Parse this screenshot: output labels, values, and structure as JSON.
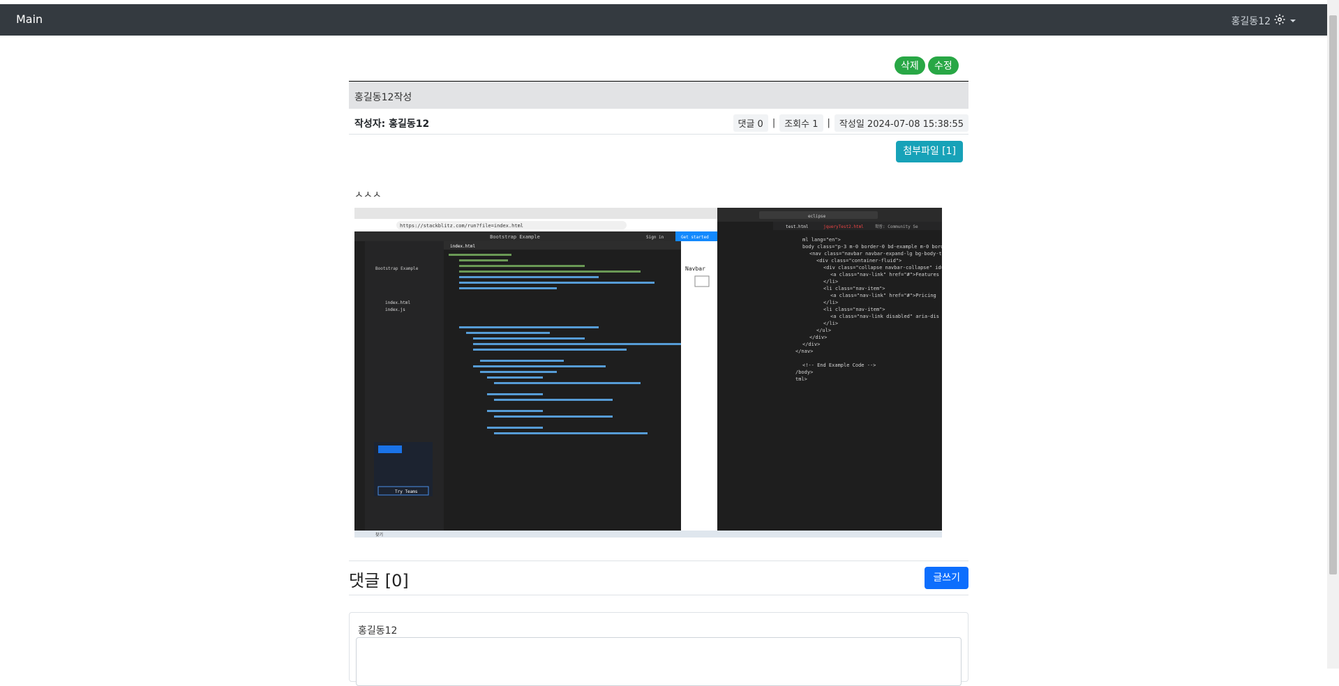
{
  "navbar": {
    "brand": "Main",
    "user": "홍길동12"
  },
  "post": {
    "delete_label": "삭제",
    "edit_label": "수정",
    "title": "홍길동12작성",
    "author": "작성자: 홍길동12",
    "comment_count": "댓글 0",
    "view_count": "조회수 1",
    "date": "작성일 2024-07-08 15:38:55",
    "attachment_label": "첨부파일 [1]",
    "content": "ㅅㅅㅅ",
    "screenshot": {
      "address": "https://stackblitz.com/run?file=index.html",
      "panel_title": "Bootstrap Example",
      "file_tab": "index.html",
      "preview_label": "Navbar",
      "sign_in": "Sign in",
      "get_started": "Get started",
      "files": [
        "index.html",
        "index.js"
      ],
      "side_title": "Bootstrap Example",
      "try_teams": "Try Teams",
      "search_box": "eclipse",
      "editor_tabs": [
        "test.html",
        "jqueryTest2.html",
        "확장: Community Se"
      ],
      "taskbar_search": "찾기",
      "code_lines": [
        "ml lang=\"en\">",
        "body class=\"p-3 m-0 border-0 bd-example m-0 borde",
        "<nav class=\"navbar navbar-expand-lg bg-body-ter",
        "<div class=\"container-fluid\">",
        "<div class=\"collapse navbar-collapse\" id=",
        "<a class=\"nav-link\" href=\"#\">Features",
        "</li>",
        "<li class=\"nav-item\">",
        "<a class=\"nav-link\" href=\"#\">Pricing",
        "</li>",
        "<li class=\"nav-item\">",
        "<a class=\"nav-link disabled\" aria-dis",
        "</li>",
        "</ul>",
        "</div>",
        "</div>",
        "</nav>",
        "",
        "<!-- End Example Code -->",
        "/body>",
        "tml>"
      ]
    }
  },
  "comments": {
    "heading": "댓글 [0]",
    "write_label": "글쓰기",
    "current_user": "홍길동12"
  },
  "colors": {
    "navbar": "#343a40",
    "success": "#28a745",
    "info": "#17a2b8",
    "primary": "#0d6efd"
  }
}
